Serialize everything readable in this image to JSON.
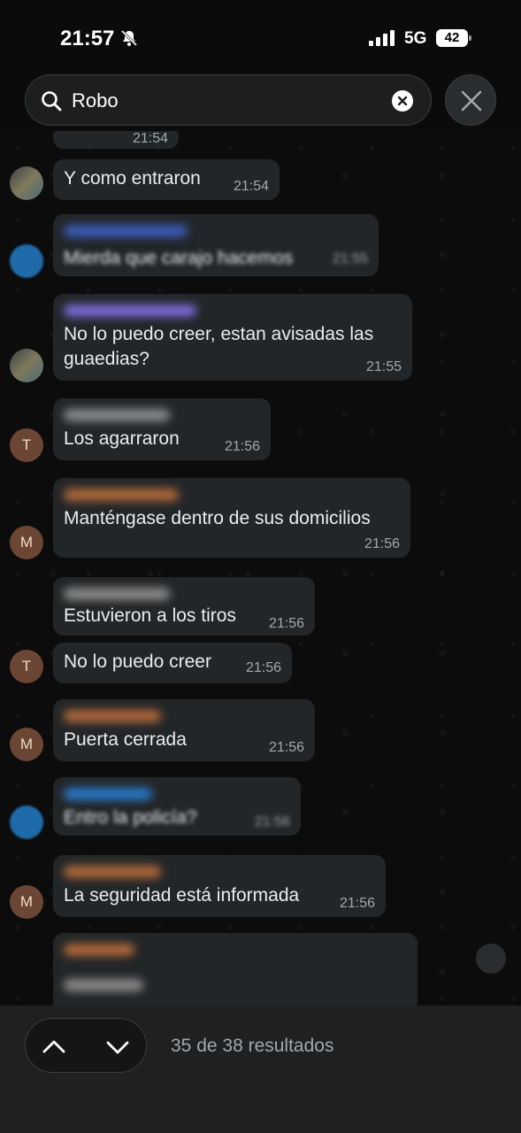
{
  "status_bar": {
    "time": "21:57",
    "network": "5G",
    "battery": "42"
  },
  "search": {
    "query": "Robo"
  },
  "messages": [
    {
      "text": "Y como entraron",
      "time": "21:54"
    },
    {
      "text": "Mierda que carajo hacemos",
      "time": "21:55"
    },
    {
      "text": "No lo puedo creer, estan avisadas las guaedias?",
      "time": "21:55"
    },
    {
      "text": "Los agarraron",
      "time": "21:56",
      "avatar": "T"
    },
    {
      "text": "Manténgase dentro de sus domicilios",
      "time": "21:56",
      "avatar": "M"
    },
    {
      "text": "Estuvieron a los tiros",
      "time": "21:56"
    },
    {
      "text": "No lo puedo creer",
      "time": "21:56",
      "avatar": "T"
    },
    {
      "text": "Puerta cerrada",
      "time": "21:56",
      "avatar": "M"
    },
    {
      "text": "Entro la policía?",
      "time": "21:56"
    },
    {
      "text": "La seguridad está informada",
      "time": "21:56",
      "avatar": "M"
    }
  ],
  "partial_top": {
    "time": "21:54"
  },
  "footer": {
    "results": "35 de 38 resultados"
  },
  "colors": {
    "bubble": "#232628",
    "header_bar": "#1e2021",
    "avatar": "#6b4634"
  }
}
